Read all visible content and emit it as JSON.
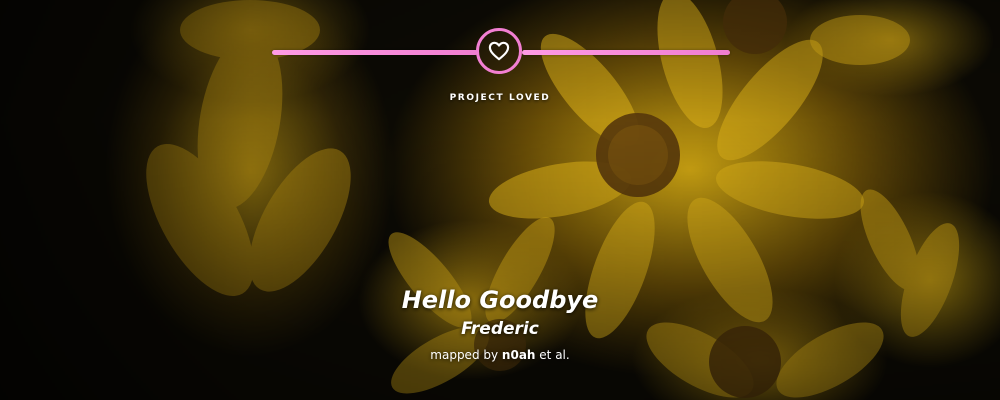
{
  "status": {
    "label": "PROJECT LOVED",
    "icon": "heart-icon",
    "accent_color": "#f27fd3"
  },
  "beatmap": {
    "title": "Hello Goodbye",
    "artist": "Frederic",
    "mapped_by_prefix": "mapped by",
    "mapper": "n0ah",
    "mapped_by_suffix": "et al."
  },
  "background": {
    "subject": "yellow-flowers"
  }
}
